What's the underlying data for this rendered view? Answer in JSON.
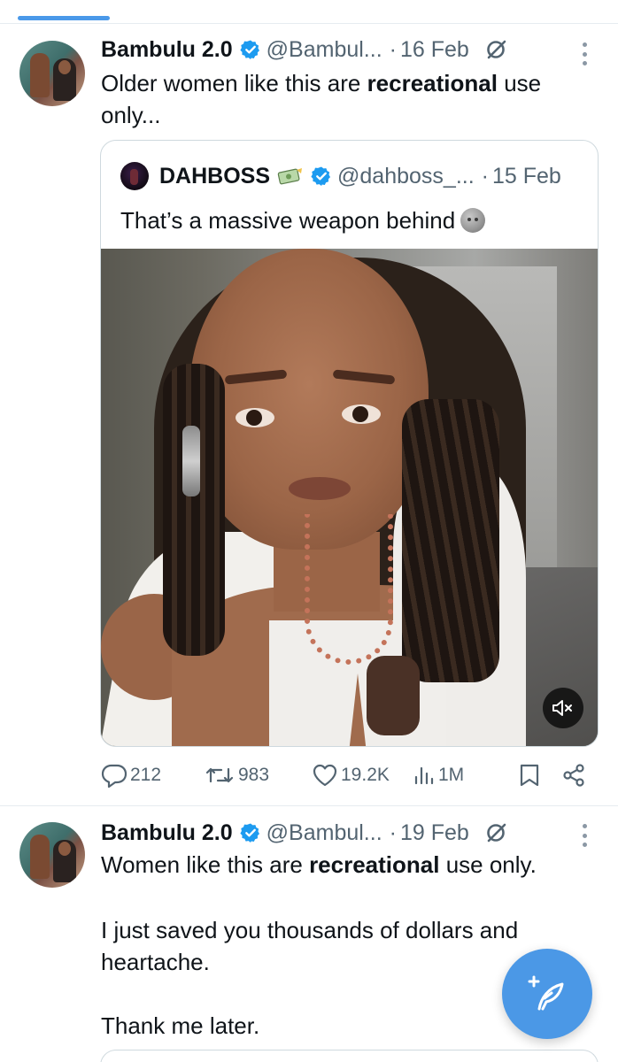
{
  "tweets": [
    {
      "author_name": "Bambulu 2.0",
      "handle": "@Bambul...",
      "separator": "·",
      "date": "16 Feb",
      "text": {
        "before": "Older women like this are ",
        "bold": "recreational",
        "after": " use only..."
      },
      "quote": {
        "author_name": "DAHBOSS",
        "handle": "@dahboss_...",
        "separator": "·",
        "date": "15 Feb",
        "text": "That’s a massive weapon behind",
        "emoji": "new-moon-face-emoji"
      },
      "stats": {
        "replies": "212",
        "reposts": "983",
        "likes": "19.2K",
        "views": "1M"
      }
    },
    {
      "author_name": "Bambulu 2.0",
      "handle": "@Bambul...",
      "separator": "·",
      "date": "19 Feb",
      "text": {
        "line1_before": "Women like this are ",
        "line1_bold": "recreational",
        "line1_after": " use only.",
        "para2": "I just saved you thousands of dollars and heartache.",
        "para3": "Thank me later."
      }
    }
  ],
  "colors": {
    "accent": "#1d9bf0",
    "fab": "#4b98e6",
    "secondary_text": "#536471",
    "border": "#cfd9de"
  },
  "icons": [
    "verified-badge-icon",
    "grok-icon",
    "more-options-icon",
    "money-bag-icon",
    "mute-icon",
    "reply-icon",
    "repost-icon",
    "like-icon",
    "views-icon",
    "bookmark-icon",
    "share-icon",
    "compose-post-icon"
  ]
}
